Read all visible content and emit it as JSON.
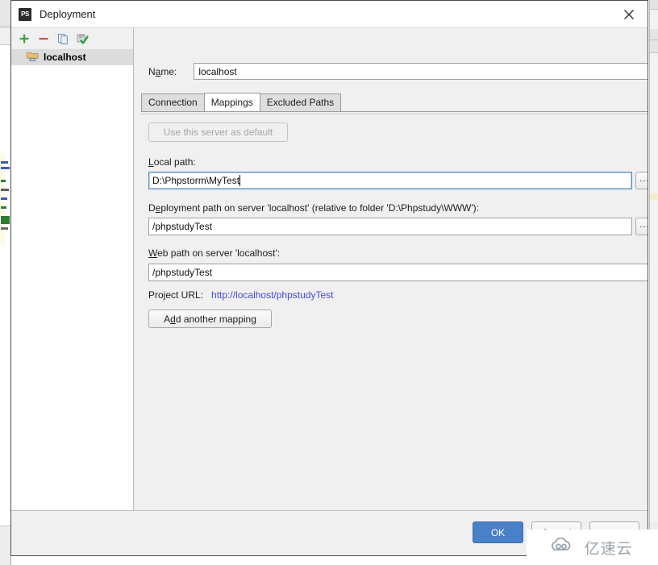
{
  "window": {
    "title": "Deployment",
    "icon": "phpstorm-icon",
    "close_icon": "close-icon"
  },
  "sidebar": {
    "toolbar": [
      {
        "name": "add-server-button",
        "icon": "plus-icon",
        "glyph": "+"
      },
      {
        "name": "remove-server-button",
        "icon": "minus-icon",
        "glyph": "−"
      },
      {
        "name": "copy-server-button",
        "icon": "copy-icon",
        "glyph": "⧉"
      },
      {
        "name": "set-default-server-button",
        "icon": "check-server-icon",
        "glyph": "✔"
      }
    ],
    "items": [
      {
        "label": "localhost",
        "icon": "server-folder-icon",
        "selected": true
      }
    ]
  },
  "form": {
    "name_label_pre": "N",
    "name_label_mnemonic": "a",
    "name_label_post": "me:",
    "name_value": "localhost",
    "tabs": [
      {
        "label": "Connection",
        "active": false
      },
      {
        "label": "Mappings",
        "active": true
      },
      {
        "label": "Excluded Paths",
        "active": false
      }
    ],
    "default_server_button": "Use this server as default",
    "default_server_button_disabled": true,
    "local_path": {
      "label_pre": "",
      "label_mnemonic": "L",
      "label_post": "ocal path:",
      "value": "D:\\Phpstorm\\MyTest",
      "focused": true,
      "browse_label": "..."
    },
    "deployment_path": {
      "label_pre": "D",
      "label_mnemonic": "e",
      "label_post": "ployment path on server 'localhost' (relative to folder 'D:\\Phpstudy\\WWW'):",
      "value": "/phpstudyTest",
      "browse_label": "..."
    },
    "web_path": {
      "label_pre": "",
      "label_mnemonic": "W",
      "label_post": "eb path on server 'localhost':",
      "value": "/phpstudyTest"
    },
    "project_url_label": "Project URL:",
    "project_url_value": "http://localhost/phpstudyTest",
    "add_mapping_pre": "A",
    "add_mapping_mnemonic": "d",
    "add_mapping_post": "d another mapping"
  },
  "footer": {
    "ok_label": "OK",
    "cancel_label": "Cancel",
    "help_label": ""
  },
  "watermark": {
    "text": "亿速云",
    "icon": "cloud-logo-icon"
  },
  "colors": {
    "accent_blue": "#4a80c8",
    "link": "#4a4ad0",
    "dialog_bg": "#f0f0f0",
    "selection": "#dcdcdc",
    "focus_border": "#5a8ec4"
  }
}
